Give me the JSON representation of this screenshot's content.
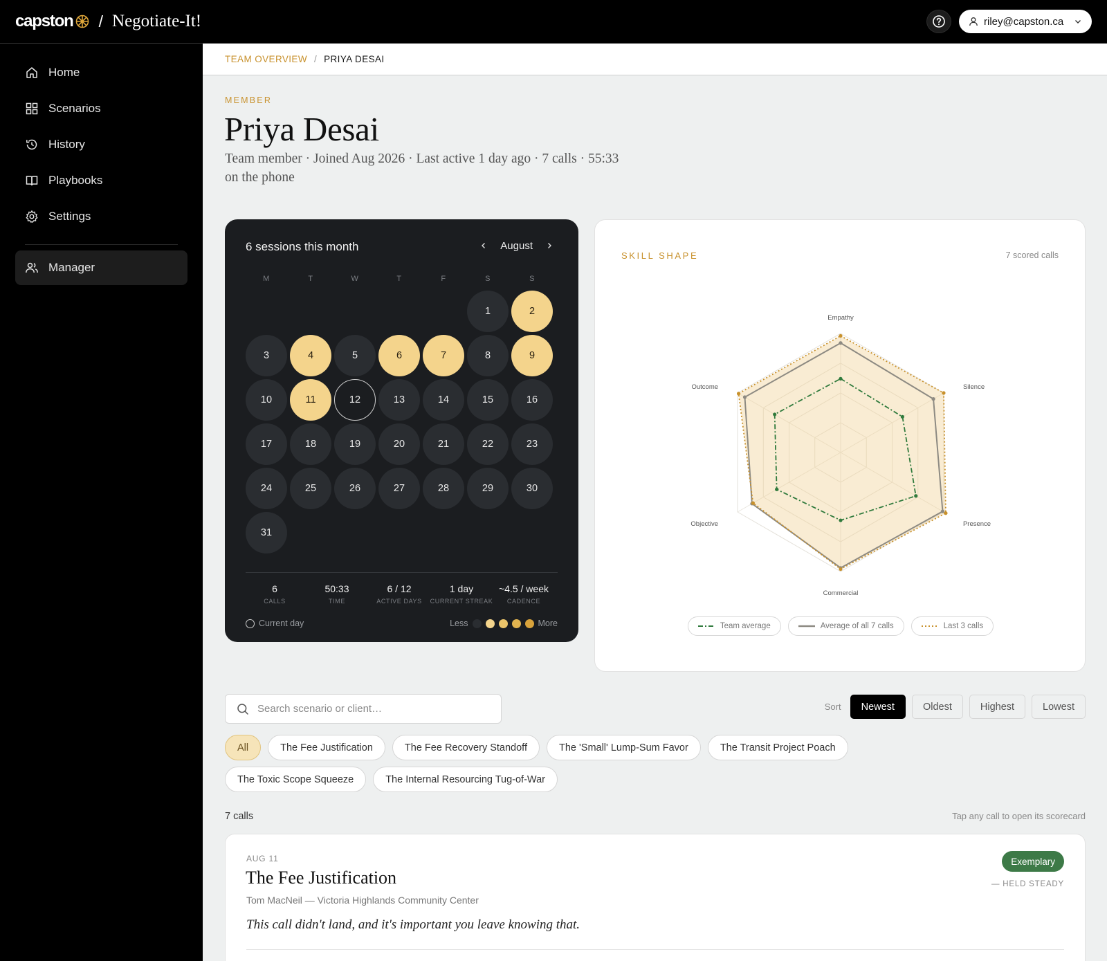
{
  "header": {
    "logo_text": "capston",
    "separator": "/",
    "app_name": "Negotiate-It!",
    "user_email": "riley@capston.ca"
  },
  "sidebar": {
    "items": [
      {
        "label": "Home",
        "icon": "home-icon"
      },
      {
        "label": "Scenarios",
        "icon": "grid-icon"
      },
      {
        "label": "History",
        "icon": "history-icon"
      },
      {
        "label": "Playbooks",
        "icon": "book-icon"
      },
      {
        "label": "Settings",
        "icon": "gear-icon"
      }
    ],
    "manager_label": "Manager"
  },
  "breadcrumb": {
    "parent": "TEAM OVERVIEW",
    "separator": "/",
    "current": "PRIYA DESAI"
  },
  "profile": {
    "eyebrow": "MEMBER",
    "name": "Priya Desai",
    "meta": "Team member · Joined Aug 2026 · Last active 1 day ago · 7 calls · 55:33 on the phone"
  },
  "calendar": {
    "title": "6 sessions this month",
    "month": "August",
    "weekdays": [
      "M",
      "T",
      "W",
      "T",
      "F",
      "S",
      "S"
    ],
    "first_weekday_index": 5,
    "days_in_month": 31,
    "active_days": [
      2,
      4,
      6,
      7,
      9,
      11
    ],
    "current_day": 12,
    "stats": [
      {
        "value": "6",
        "label": "CALLS"
      },
      {
        "value": "50:33",
        "label": "TIME"
      },
      {
        "value": "6 / 12",
        "label": "ACTIVE DAYS"
      },
      {
        "value": "1 day",
        "label": "CURRENT STREAK"
      },
      {
        "value": "~4.5 / week",
        "label": "CADENCE"
      }
    ],
    "legend_current": "Current day",
    "legend_less": "Less",
    "legend_more": "More",
    "heat_colors": [
      "#2a2d31",
      "#f4d48c",
      "#ecc56a",
      "#e2b450",
      "#d9a33b"
    ]
  },
  "skill": {
    "title": "SKILL SHAPE",
    "count": "7 scored calls",
    "axes": [
      "Empathy",
      "Silence",
      "Presence",
      "Commercial",
      "Objective",
      "Outcome"
    ],
    "series": [
      {
        "name": "Team average",
        "values": [
          0.62,
          0.6,
          0.73,
          0.57,
          0.62,
          0.64
        ],
        "color": "#2f7a3c",
        "dash": "7 3 2 3"
      },
      {
        "name": "Average of all 7 calls",
        "values": [
          0.92,
          0.9,
          0.99,
          0.97,
          0.86,
          0.93
        ],
        "color": "#8d8a82",
        "dash": ""
      },
      {
        "name": "Last 3 calls",
        "values": [
          0.98,
          1.0,
          1.02,
          0.98,
          0.85,
          0.99
        ],
        "color": "#c8912c",
        "dash": "2 3"
      }
    ],
    "legend": [
      "Team average",
      "Average of all 7 calls",
      "Last 3 calls"
    ]
  },
  "filters": {
    "search_placeholder": "Search scenario or client…",
    "sort_label": "Sort",
    "sort_options": [
      "Newest",
      "Oldest",
      "Highest",
      "Lowest"
    ],
    "sort_active": "Newest",
    "chips": [
      "All",
      "The Fee Justification",
      "The Fee Recovery Standoff",
      "The 'Small' Lump-Sum Favor",
      "The Transit Project Poach",
      "The Toxic Scope Squeeze",
      "The Internal Resourcing Tug-of-War"
    ],
    "chip_active": "All"
  },
  "calls": {
    "count": "7 calls",
    "hint": "Tap any call to open its scorecard",
    "items": [
      {
        "date": "AUG 11",
        "title": "The Fee Justification",
        "client": "Tom MacNeil — Victoria Highlands Community Center",
        "quote": "This call didn't land, and it's important you leave knowing that.",
        "badge": "Exemplary",
        "tag": "— HELD STEADY"
      }
    ]
  }
}
